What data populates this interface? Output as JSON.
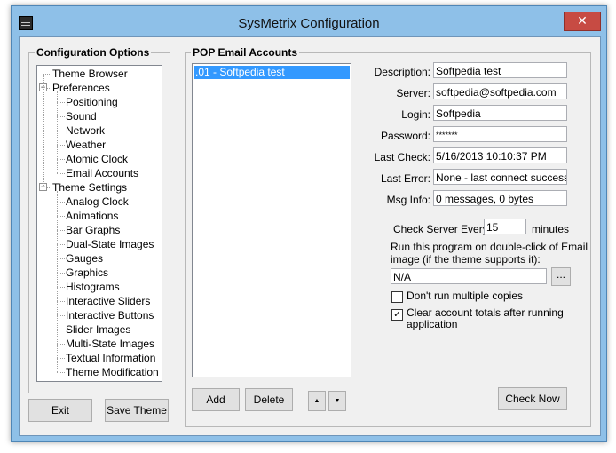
{
  "window": {
    "title": "SysMetrix Configuration",
    "close_glyph": "✕"
  },
  "config_options": {
    "group_label": "Configuration Options",
    "tree": [
      {
        "label": "Theme Browser"
      },
      {
        "label": "Preferences",
        "expanded": true
      },
      {
        "label": "Positioning"
      },
      {
        "label": "Sound"
      },
      {
        "label": "Network"
      },
      {
        "label": "Weather"
      },
      {
        "label": "Atomic Clock"
      },
      {
        "label": "Email Accounts"
      },
      {
        "label": "Theme Settings",
        "expanded": true
      },
      {
        "label": "Analog Clock"
      },
      {
        "label": "Animations"
      },
      {
        "label": "Bar Graphs"
      },
      {
        "label": "Dual-State Images"
      },
      {
        "label": "Gauges"
      },
      {
        "label": "Graphics"
      },
      {
        "label": "Histograms"
      },
      {
        "label": "Interactive Sliders"
      },
      {
        "label": "Interactive Buttons"
      },
      {
        "label": "Slider Images"
      },
      {
        "label": "Multi-State Images"
      },
      {
        "label": "Textual Information"
      },
      {
        "label": "Theme Modification"
      }
    ],
    "expander_glyph": "−"
  },
  "buttons": {
    "exit": "Exit",
    "save_theme": "Save Theme",
    "add": "Add",
    "delete": "Delete",
    "up": "▲",
    "down": "▼",
    "check_now": "Check Now",
    "browse": "..."
  },
  "pop": {
    "group_label": "POP Email Accounts",
    "accounts": [
      ".01 - Softpedia test"
    ],
    "fields": {
      "description": {
        "label": "Description:",
        "value": "Softpedia test"
      },
      "server": {
        "label": "Server:",
        "value": "softpedia@softpedia.com"
      },
      "login": {
        "label": "Login:",
        "value": "Softpedia"
      },
      "password": {
        "label": "Password:",
        "value": "*******"
      },
      "last_check": {
        "label": "Last Check:",
        "value": "5/16/2013 10:10:37 PM"
      },
      "last_error": {
        "label": "Last Error:",
        "value": "None - last connect successful"
      },
      "msg_info": {
        "label": "Msg Info:",
        "value": "0 messages, 0 bytes"
      }
    },
    "check_every_label": "Check Server Every:",
    "check_every_value": "15",
    "minutes_label": "minutes",
    "run_label_line1": "Run this program on double-click of Email",
    "run_label_line2": "image (if the theme supports it):",
    "run_value": "N/A",
    "dont_run_multiple": {
      "label": "Don't run multiple copies",
      "checked": false
    },
    "clear_totals": {
      "label_line1": "Clear account totals after running",
      "label_line2": "application",
      "checked": true,
      "glyph": "✓"
    }
  }
}
